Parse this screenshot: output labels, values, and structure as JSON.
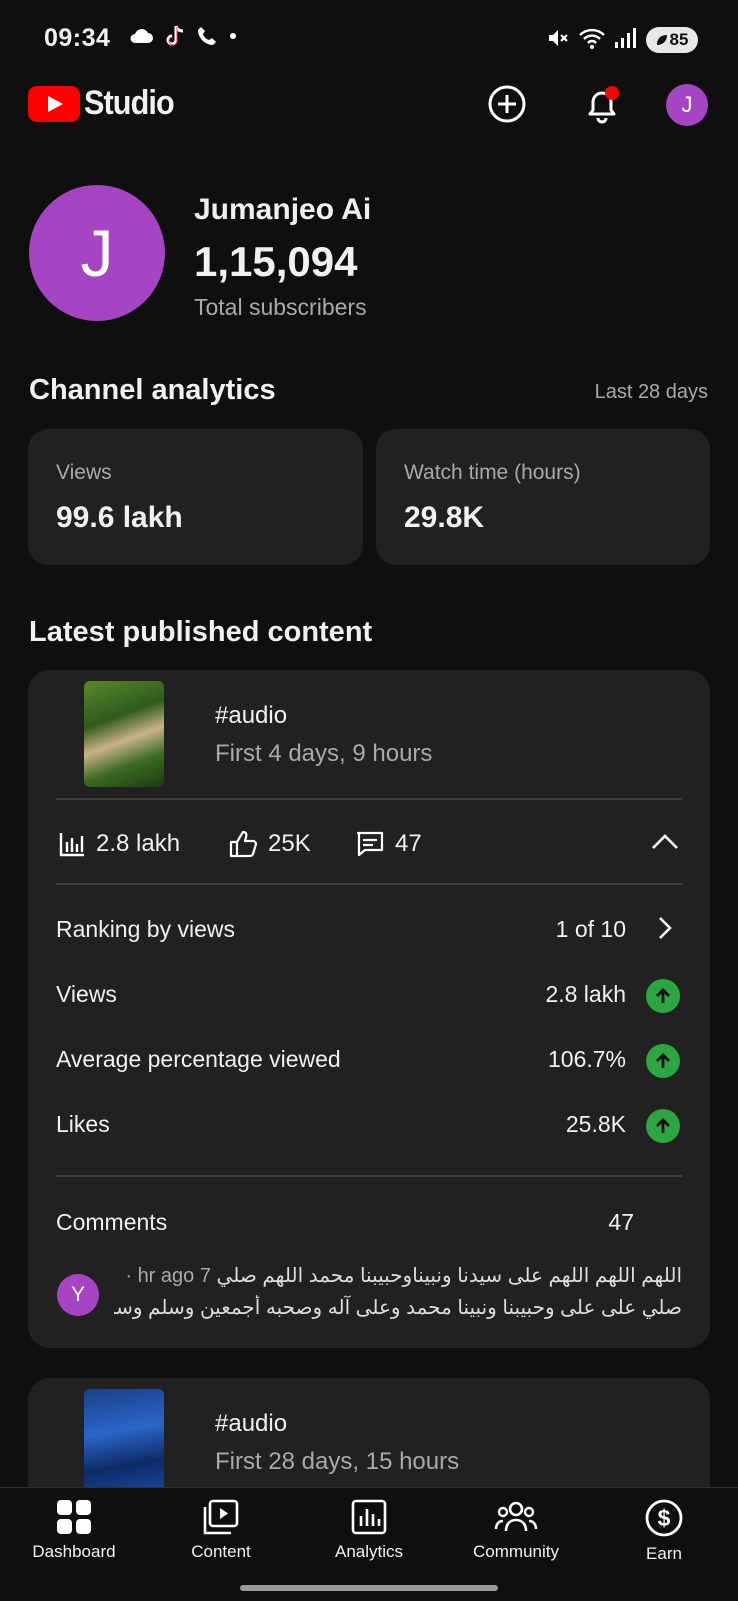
{
  "status_bar": {
    "time": "09:34",
    "battery": "85",
    "icons_left": [
      "cloud-icon",
      "tiktok-icon",
      "phone-icon",
      "dot-icon"
    ],
    "icons_right": [
      "mute-icon",
      "wifi-icon",
      "signal-icon"
    ]
  },
  "header": {
    "app_name": "Studio",
    "avatar_letter": "J"
  },
  "channel": {
    "avatar_letter": "J",
    "name": "Jumanjeo Ai",
    "subscribers": "1,15,094",
    "subscribers_label": "Total subscribers"
  },
  "analytics": {
    "title": "Channel analytics",
    "period": "Last 28 days",
    "cards": [
      {
        "label": "Views",
        "value": "99.6 lakh"
      },
      {
        "label": "Watch time (hours)",
        "value": "29.8K"
      }
    ]
  },
  "latest": {
    "title": "Latest published content",
    "items": [
      {
        "title": "#audio",
        "subtitle": "First 4 days, 9 hours",
        "views": "2.8 lakh",
        "likes": "25K",
        "comments": "47",
        "details": {
          "ranking_label": "Ranking by views",
          "ranking_value": "1 of 10",
          "rows": [
            {
              "label": "Views",
              "value": "2.8 lakh"
            },
            {
              "label": "Average percentage viewed",
              "value": "106.7%"
            },
            {
              "label": "Likes",
              "value": "25.8K"
            }
          ],
          "comments_label": "Comments",
          "comments_value": "47",
          "comment": {
            "avatar_letter": "Y",
            "meta": "7 hr ago ·",
            "line1": "اللهم اللهم اللهم على سيدنا ونبيناوحبيبنا محمد اللهم صلي",
            "line2": "صلي على على وحبيبنا ونبينا محمد وعلى آله وصحبه أجمعين وسلم وسل..."
          }
        }
      },
      {
        "title": "#audio",
        "subtitle": "First 28 days, 15 hours"
      }
    ]
  },
  "bottom_nav": [
    {
      "label": "Dashboard",
      "icon": "dashboard-icon"
    },
    {
      "label": "Content",
      "icon": "content-icon"
    },
    {
      "label": "Analytics",
      "icon": "analytics-icon"
    },
    {
      "label": "Community",
      "icon": "community-icon"
    },
    {
      "label": "Earn",
      "icon": "earn-icon"
    }
  ],
  "colors": {
    "background": "#0f0f0f",
    "card": "#212121",
    "accent_red": "#ff0000",
    "avatar_purple": "#a545c4",
    "up_green": "#2ba640"
  }
}
